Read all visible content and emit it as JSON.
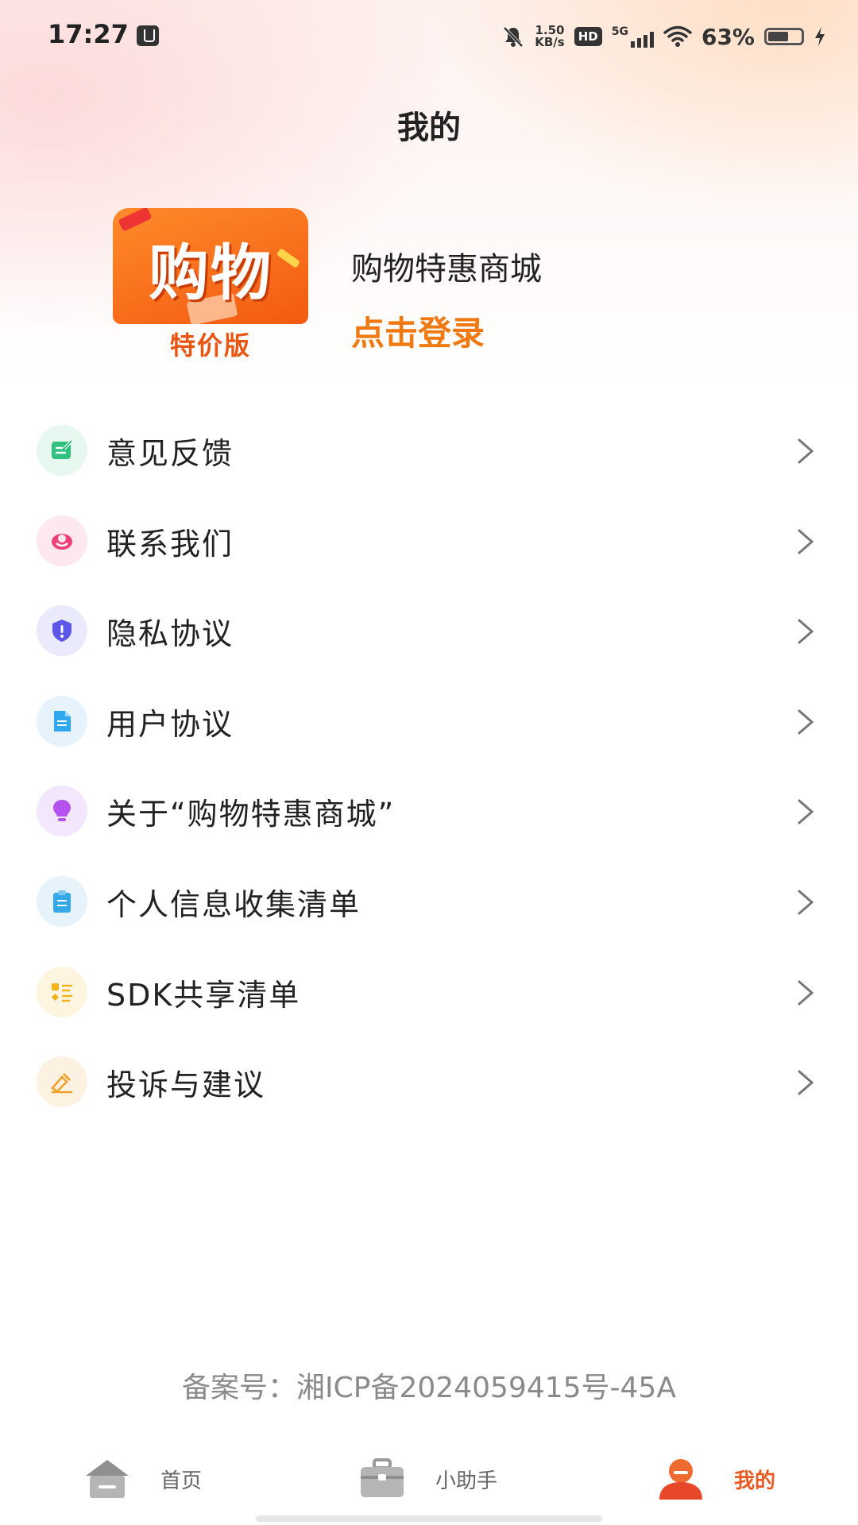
{
  "status_bar": {
    "time": "17:27",
    "net_speed_value": "1.50",
    "net_speed_unit": "KB/s",
    "hd": "HD",
    "network": "5G",
    "battery_pct": "63%",
    "battery_level": 0.63
  },
  "header": {
    "title": "我的"
  },
  "profile": {
    "logo_main": "购物",
    "logo_sub": "特价版",
    "app_name": "购物特惠商城",
    "login_label": "点击登录"
  },
  "menu": {
    "items": [
      {
        "label": "意见反馈",
        "icon": "feedback-icon",
        "color": "#2ec27e",
        "bg": "#e6f8ef"
      },
      {
        "label": "联系我们",
        "icon": "headset-icon",
        "color": "#f0407a",
        "bg": "#fde8ef"
      },
      {
        "label": "隐私协议",
        "icon": "shield-icon",
        "color": "#5b57e8",
        "bg": "#ebeafc"
      },
      {
        "label": "用户协议",
        "icon": "document-icon",
        "color": "#2fa8f0",
        "bg": "#e6f3fd"
      },
      {
        "label": "关于“购物特惠商城”",
        "icon": "lightbulb-icon",
        "color": "#b552ef",
        "bg": "#f3e7fd"
      },
      {
        "label": "个人信息收集清单",
        "icon": "clipboard-icon",
        "color": "#35a9e8",
        "bg": "#e6f3fb"
      },
      {
        "label": "SDK共享清单",
        "icon": "list-icon",
        "color": "#f2b31c",
        "bg": "#fdf5e0"
      },
      {
        "label": "投诉与建议",
        "icon": "complaint-icon",
        "color": "#f0a02a",
        "bg": "#fdf2e2"
      }
    ]
  },
  "footer": {
    "icp": "备案号：湘ICP备2024059415号-45A"
  },
  "bottom_nav": {
    "home": "首页",
    "assistant": "小助手",
    "mine": "我的",
    "active_color": "#e85a22"
  }
}
